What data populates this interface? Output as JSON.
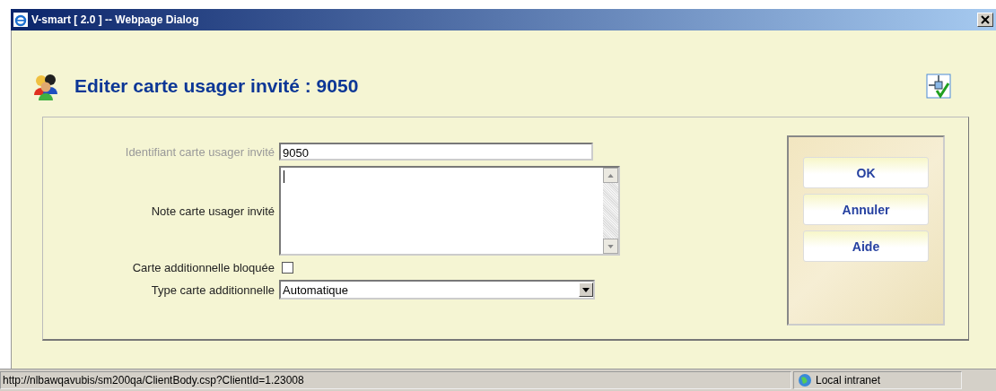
{
  "window": {
    "title": "V-smart [ 2.0 ] -- Webpage Dialog"
  },
  "heading": "Editer carte usager invité : 9050",
  "fields": [
    {
      "kind": "text",
      "label": "Identifiant carte usager invité",
      "value": "9050",
      "disabled": true
    },
    {
      "kind": "textarea",
      "label": "Note carte usager invité",
      "disabled": false
    },
    {
      "kind": "checkbox",
      "label": "Carte additionnelle bloquée",
      "checked": false,
      "disabled": false
    },
    {
      "kind": "select",
      "label": "Type carte additionnelle",
      "value": "Automatique",
      "disabled": false
    }
  ],
  "buttons": [
    "OK",
    "Annuler",
    "Aide"
  ],
  "status_bar": {
    "url": "http://nlbawqavubis/sm200qa/ClientBody.csp?ClientId=1.23008",
    "zone": "Local intranet"
  }
}
